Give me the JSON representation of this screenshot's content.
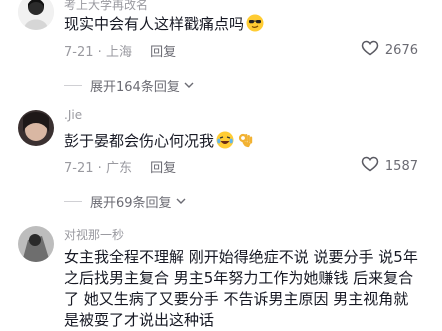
{
  "comments": [
    {
      "username": "考上大学再改名",
      "text": "现实中会有人这样戳痛点吗",
      "date": "7-21",
      "location": "上海",
      "reply_label": "回复",
      "likes": "2676",
      "expand_label": "展开164条回复"
    },
    {
      "username": ".Jie",
      "text": "彭于晏都会伤心何况我",
      "date": "7-21",
      "location": "广东",
      "reply_label": "回复",
      "likes": "1587",
      "expand_label": "展开69条回复"
    },
    {
      "username": "对视那一秒",
      "text": "女主我全程不理解 刚开始得绝症不说 说要分手 说5年之后找男主复合 男主5年努力工作为她赚钱 后来复合了 她又生病了又要分手 不告诉男主原因 男主视角就是被耍了才说出这种话"
    }
  ],
  "icons": {
    "like": "heart-outline-icon",
    "expand": "chevron-down-icon",
    "emoji_1": "sunglasses-emoji",
    "emoji_2a": "laughing-tears-emoji",
    "emoji_2b": "ok-hand-emoji"
  }
}
